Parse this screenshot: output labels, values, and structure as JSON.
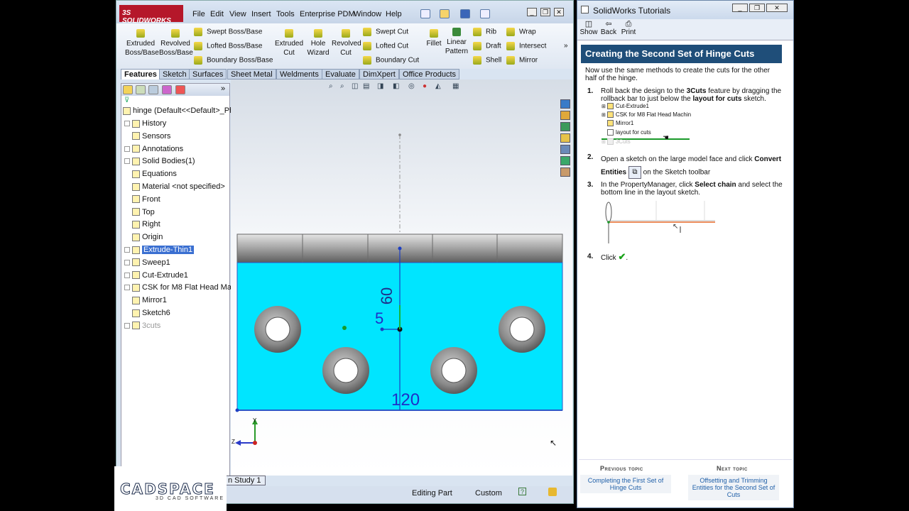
{
  "solidworks": {
    "logo_text": "3S SOLIDWORKS",
    "menu": [
      "File",
      "Edit",
      "View",
      "Insert",
      "Tools",
      "Enterprise PDM",
      "Window",
      "Help"
    ],
    "command_manager": {
      "extruded_boss": "Extruded Boss/Base",
      "revolved_boss": "Revolved Boss/Base",
      "swept_boss": "Swept Boss/Base",
      "lofted_boss": "Lofted Boss/Base",
      "boundary_boss": "Boundary Boss/Base",
      "extruded_cut": "Extruded Cut",
      "hole_wizard": "Hole Wizard",
      "revolved_cut": "Revolved Cut",
      "swept_cut": "Swept Cut",
      "lofted_cut": "Lofted Cut",
      "boundary_cut": "Boundary Cut",
      "fillet": "Fillet",
      "linear_pattern": "Linear Pattern",
      "rib": "Rib",
      "draft": "Draft",
      "shell": "Shell",
      "wrap": "Wrap",
      "intersect": "Intersect",
      "mirror": "Mirror"
    },
    "tabs": [
      "Features",
      "Sketch",
      "Surfaces",
      "Sheet Metal",
      "Weldments",
      "Evaluate",
      "DimXpert",
      "Office Products"
    ],
    "tree": {
      "root": "hinge  (Default<<Default>_Ph",
      "items": [
        {
          "label": "History",
          "expand": true
        },
        {
          "label": "Sensors",
          "expand": false
        },
        {
          "label": "Annotations",
          "expand": true
        },
        {
          "label": "Solid Bodies(1)",
          "expand": true
        },
        {
          "label": "Equations",
          "expand": false
        },
        {
          "label": "Material <not specified>",
          "expand": false
        },
        {
          "label": "Front",
          "expand": false
        },
        {
          "label": "Top",
          "expand": false
        },
        {
          "label": "Right",
          "expand": false
        },
        {
          "label": "Origin",
          "expand": false
        },
        {
          "label": "Extrude-Thin1",
          "expand": true
        },
        {
          "label": "Sweep1",
          "expand": true
        },
        {
          "label": "Cut-Extrude1",
          "expand": true
        },
        {
          "label": "CSK for M8 Flat Head Mach",
          "expand": true
        },
        {
          "label": "Mirror1",
          "expand": false
        },
        {
          "label": "Sketch6",
          "expand": false
        },
        {
          "label": "3cuts",
          "expand": true
        }
      ]
    },
    "dimensions": {
      "d1": "60",
      "d2": "5",
      "d3": "120"
    },
    "triad": {
      "y": "Y",
      "z": "Z"
    },
    "study_tab": "n Study 1",
    "status": {
      "mode": "Editing Part",
      "units": "Custom",
      "help": "?"
    }
  },
  "tutorial": {
    "window_title": "SolidWorks Tutorials",
    "toolbar": {
      "show": "Show",
      "back": "Back",
      "print": "Print"
    },
    "heading": "Creating the Second Set of Hinge Cuts",
    "intro": "Now use the same methods to create the cuts for the other half of the hinge.",
    "steps": {
      "s1_num": "1.",
      "s1_a": "Roll back the design to the ",
      "s1_b": "3Cuts",
      "s1_c": " feature by dragging the rollback bar to just below the ",
      "s1_d": "layout for cuts",
      "s1_e": " sketch.",
      "s2_num": "2.",
      "s2_a": "Open a sketch on the large model face and click ",
      "s2_b": "Convert Entities",
      "s2_c": " on the Sketch toolbar",
      "s3_num": "3.",
      "s3_a": "In the PropertyManager, click ",
      "s3_b": "Select chain",
      "s3_c": " and select the bottom line in the layout sketch.",
      "s4_num": "4.",
      "s4_a": "Click",
      "s4_b": "."
    },
    "mini_tree": [
      "Cut-Extrude1",
      "CSK for M8 Flat Head Machin",
      "Mirror1",
      "layout for cuts",
      "3Cuts"
    ],
    "prev_label": "Previous topic",
    "prev_link": "Completing the First Set of Hinge Cuts",
    "next_label": "Next topic",
    "next_link": "Offsetting and Trimming Entities for the Second Set of Cuts"
  },
  "watermark": {
    "brand": "CADSPACE",
    "tagline": "3D CAD SOFTWARE"
  }
}
